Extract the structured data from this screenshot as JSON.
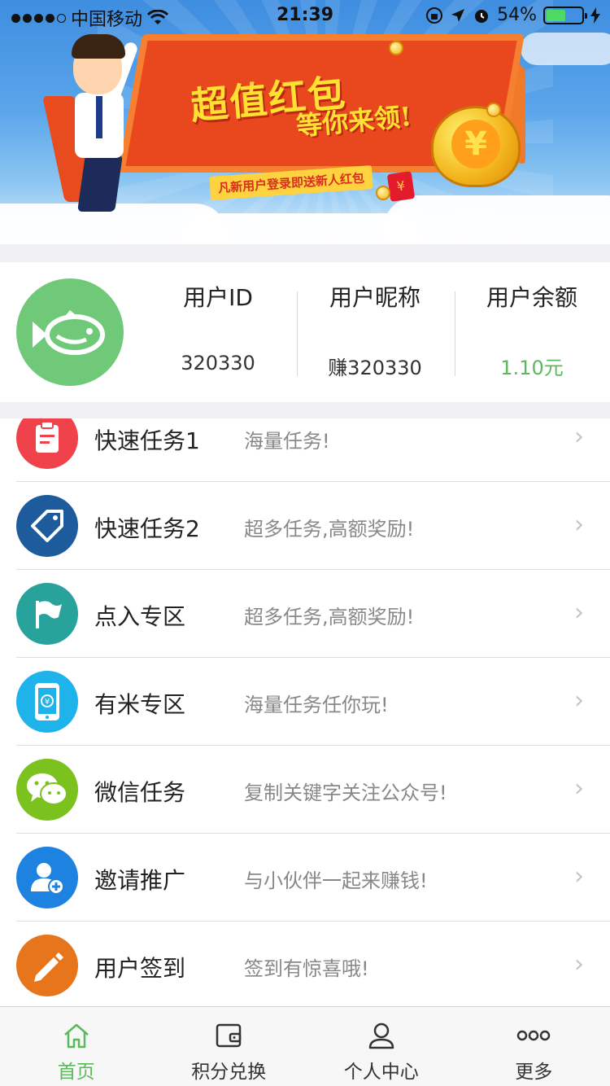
{
  "status_bar": {
    "carrier": "中国移动",
    "time": "21:39",
    "battery": "54%",
    "battery_level": 0.54
  },
  "banner": {
    "title": "超值红包",
    "subtitle": "等你来领!",
    "note": "凡新用户登录即送新人红包",
    "envelope_symbol": "¥",
    "bag_symbol": "¥",
    "pages": 3,
    "active_page": 1
  },
  "user": {
    "id_label": "用户ID",
    "id_value": "320330",
    "nick_label": "用户昵称",
    "nick_value": "赚320330",
    "balance_label": "用户余额",
    "balance_value": "1.10元",
    "balance_color": "#5cb85c"
  },
  "list": [
    {
      "title": "快速任务1",
      "desc": "海量任务!",
      "icon": "clipboard-icon",
      "color": "#f0424a"
    },
    {
      "title": "快速任务2",
      "desc": "超多任务,高额奖励!",
      "icon": "tag-icon",
      "color": "#1d5b9c"
    },
    {
      "title": "点入专区",
      "desc": "超多任务,高额奖励!",
      "icon": "flag-icon",
      "color": "#27a39c"
    },
    {
      "title": "有米专区",
      "desc": "海量任务任你玩!",
      "icon": "phone-yen-icon",
      "color": "#1fb3ec"
    },
    {
      "title": "微信任务",
      "desc": "复制关键字关注公众号!",
      "icon": "wechat-icon",
      "color": "#7cc21e"
    },
    {
      "title": "邀请推广",
      "desc": "与小伙伴一起来赚钱!",
      "icon": "add-user-icon",
      "color": "#1e83e0"
    },
    {
      "title": "用户签到",
      "desc": "签到有惊喜哦!",
      "icon": "pencil-icon",
      "color": "#e6751c"
    }
  ],
  "chevron": "›",
  "tabs": [
    {
      "label": "首页",
      "icon": "home-icon",
      "active": true
    },
    {
      "label": "积分兑换",
      "icon": "wallet-icon",
      "active": false
    },
    {
      "label": "个人中心",
      "icon": "person-icon",
      "active": false
    },
    {
      "label": "更多",
      "icon": "more-icon",
      "active": false
    }
  ],
  "colors": {
    "accent": "#5cb85c"
  }
}
